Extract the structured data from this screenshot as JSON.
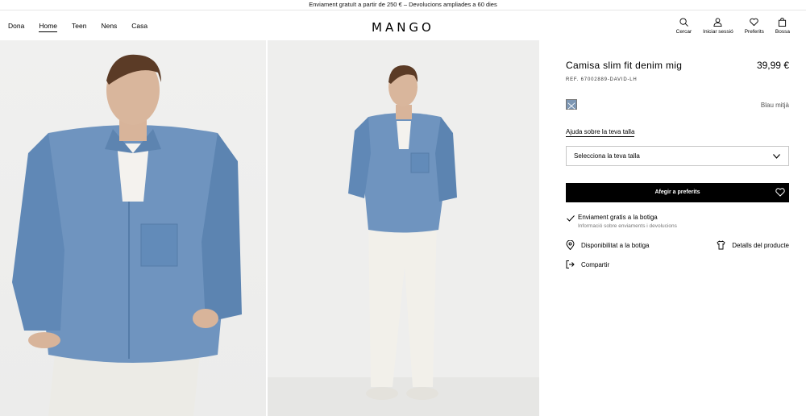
{
  "promo": {
    "text": "Enviament gratuït a partir de 250 € – Devolucions ampliades a 60 dies"
  },
  "nav": {
    "items": [
      {
        "label": "Dona",
        "active": false
      },
      {
        "label": "Home",
        "active": true
      },
      {
        "label": "Teen",
        "active": false
      },
      {
        "label": "Nens",
        "active": false
      },
      {
        "label": "Casa",
        "active": false
      }
    ]
  },
  "logo": {
    "text": "MANGO"
  },
  "header_actions": {
    "search": {
      "label": "Cercar",
      "icon": "search-icon"
    },
    "login": {
      "label": "Iniciar sessió",
      "icon": "user-icon"
    },
    "favorites": {
      "label": "Preferits",
      "icon": "heart-icon"
    },
    "bag": {
      "label": "Bossa",
      "icon": "bag-icon"
    }
  },
  "product": {
    "title": "Camisa slim fit denim mig",
    "price": "39,99 €",
    "ref": "REF. 67002889-DAVID-LH",
    "color_name": "Blau mitjà",
    "swatch_color": "#7c96b3",
    "size_help": "Ajuda sobre la teva talla",
    "size_placeholder": "Selecciona la teva talla",
    "fav_button": "Afegir a preferits",
    "shipping_title": "Enviament gratis a la botiga",
    "shipping_sub": "Informació sobre enviaments i devolucions",
    "availability": "Disponibilitat a la botiga",
    "details": "Detalls del producte",
    "share": "Compartir"
  },
  "colors": {
    "denim": "#6d90bb",
    "denim_dark": "#5478a4",
    "background": "#efefee"
  }
}
